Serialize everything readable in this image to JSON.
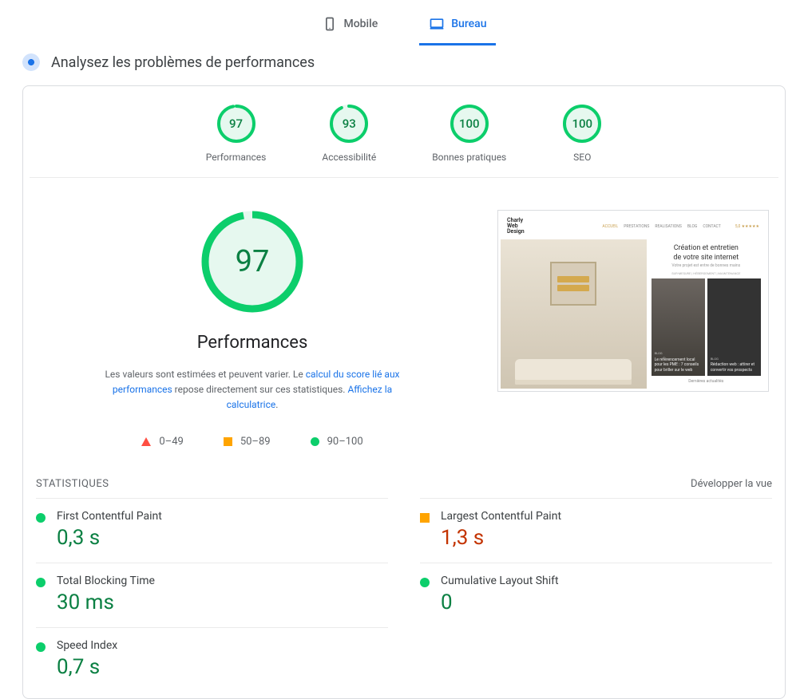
{
  "tabs": {
    "mobile": "Mobile",
    "bureau": "Bureau"
  },
  "banner": "Analysez les problèmes de performances",
  "scores": [
    {
      "value": "97",
      "label": "Performances",
      "pct": 97
    },
    {
      "value": "93",
      "label": "Accessibilité",
      "pct": 93
    },
    {
      "value": "100",
      "label": "Bonnes pratiques",
      "pct": 100
    },
    {
      "value": "100",
      "label": "SEO",
      "pct": 100
    }
  ],
  "main": {
    "big_value": "97",
    "big_pct": 97,
    "big_title": "Performances",
    "disclaimer_pre": "Les valeurs sont estimées et peuvent varier. Le ",
    "disclaimer_link1": "calcul du score lié aux performances",
    "disclaimer_mid": " repose directement sur ces statistiques. ",
    "disclaimer_link2": "Affichez la calculatrice",
    "disclaimer_post": "."
  },
  "legend": {
    "low": "0–49",
    "mid": "50–89",
    "high": "90–100"
  },
  "thumb": {
    "logo1": "Charly",
    "logo2": "Web",
    "logo3": "Design",
    "nav1": "ACCUEIL",
    "nav2": "PRESTATIONS",
    "nav3": "REALISATIONS",
    "nav4": "BLOG",
    "nav5": "CONTACT",
    "stars": "5,0 ★★★★★",
    "title1": "Création et entretien",
    "title2": "de votre site internet",
    "sub": "Votre projet est entre de bonnes mains",
    "meta": "SUR-MESURE | HÉBERGEMENT | MAINTENANCE",
    "card1tag": "BLOG",
    "card1text": "Le référencement local pour les PME : 7 conseils pour briller sur le web",
    "card2tag": "BLOG",
    "card2text": "Rédaction web : attirer et convertir vos prospects",
    "footer": "Dernières actualités"
  },
  "stats": {
    "title": "STATISTIQUES",
    "expand": "Développer la vue"
  },
  "metrics": [
    {
      "name": "First Contentful Paint",
      "value": "0,3 s",
      "status": "green"
    },
    {
      "name": "Largest Contentful Paint",
      "value": "1,3 s",
      "status": "orange"
    },
    {
      "name": "Total Blocking Time",
      "value": "30 ms",
      "status": "green"
    },
    {
      "name": "Cumulative Layout Shift",
      "value": "0",
      "status": "green"
    },
    {
      "name": "Speed Index",
      "value": "0,7 s",
      "status": "green"
    }
  ]
}
